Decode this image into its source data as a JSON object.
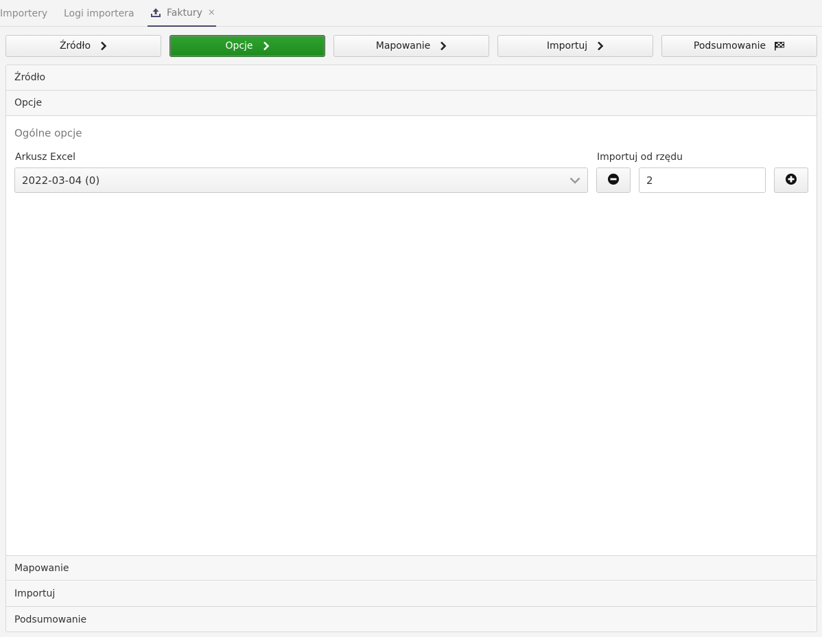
{
  "tabs": [
    {
      "label": "Importery"
    },
    {
      "label": "Logi importera"
    },
    {
      "label": "Faktury",
      "active": true,
      "icon": "upload-icon",
      "close": "×"
    }
  ],
  "steps": [
    {
      "label": "Źródło",
      "icon": "chevron-right-icon"
    },
    {
      "label": "Opcje",
      "icon": "chevron-right-icon",
      "active": true
    },
    {
      "label": "Mapowanie",
      "icon": "chevron-right-icon"
    },
    {
      "label": "Importuj",
      "icon": "chevron-right-icon"
    },
    {
      "label": "Podsumowanie",
      "icon": "checkered-flag-icon"
    }
  ],
  "accordion": {
    "source": "Źródło",
    "options": "Opcje",
    "mapping": "Mapowanie",
    "import": "Importuj",
    "summary": "Podsumowanie"
  },
  "options": {
    "section_title": "Ogólne opcje",
    "sheet_label": "Arkusz Excel",
    "sheet_value": "2022-03-04 (0)",
    "row_label": "Importuj od rzędu",
    "row_value": "2"
  },
  "colors": {
    "active_step": "#2a9a2a",
    "tab_underline": "#4a4a6a"
  }
}
